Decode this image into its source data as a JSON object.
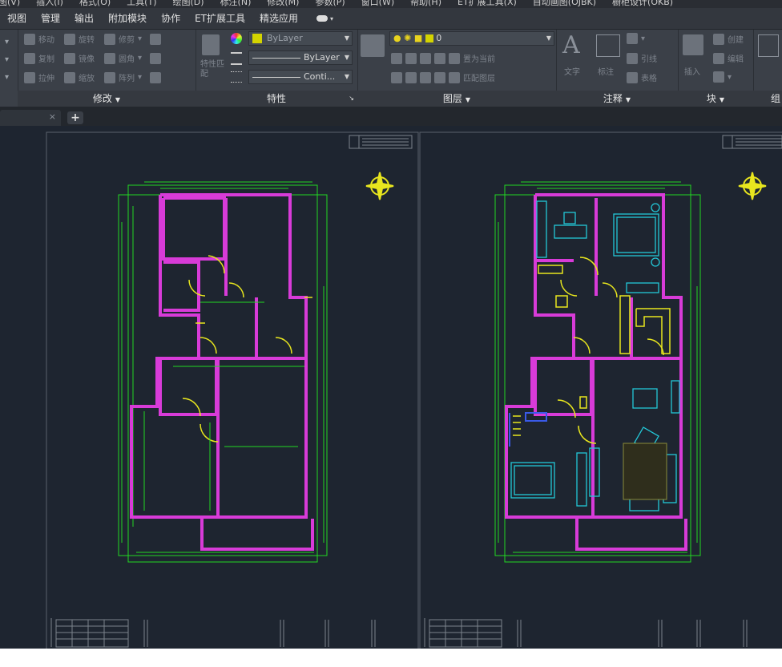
{
  "menubar": {
    "items": [
      "图(V)",
      "插入(I)",
      "格式(O)",
      "工具(T)",
      "绘图(D)",
      "标注(N)",
      "修改(M)",
      "参数(P)",
      "窗口(W)",
      "帮助(H)",
      "ET扩展工具(X)",
      "自动画图(OJBK)",
      "橱柜设计(OKB)"
    ]
  },
  "ribbon_tabs": [
    "视图",
    "管理",
    "输出",
    "附加模块",
    "协作",
    "ET扩展工具",
    "精选应用"
  ],
  "panels": {
    "modify": "修改",
    "properties": "特性",
    "layers": "图层",
    "annotation": "注释",
    "block": "块",
    "group": "组"
  },
  "modify_tools": [
    "移动",
    "旋转",
    "修剪",
    "复制",
    "镜像",
    "圆角",
    "拉伸",
    "缩放",
    "阵列"
  ],
  "properties": {
    "color_value": "ByLayer",
    "linetype_value": "ByLayer",
    "lineweight_value": "Conti...",
    "match_label": "特性匹配"
  },
  "layers": {
    "current_layer": "0",
    "make_current": "置为当前",
    "match_layer": "匹配图层"
  },
  "annotation": {
    "text_label": "文字",
    "dim_label": "标注",
    "leader_label": "引线",
    "table_label": "表格"
  },
  "block": {
    "insert_label": "插入",
    "create_label": "创建",
    "edit_label": "编辑"
  },
  "colors": {
    "wall": "#d83bd8",
    "dimension": "#22d822",
    "door": "#e8e61e",
    "furniture": "#23c8d8",
    "compass": "#e8e61e"
  }
}
